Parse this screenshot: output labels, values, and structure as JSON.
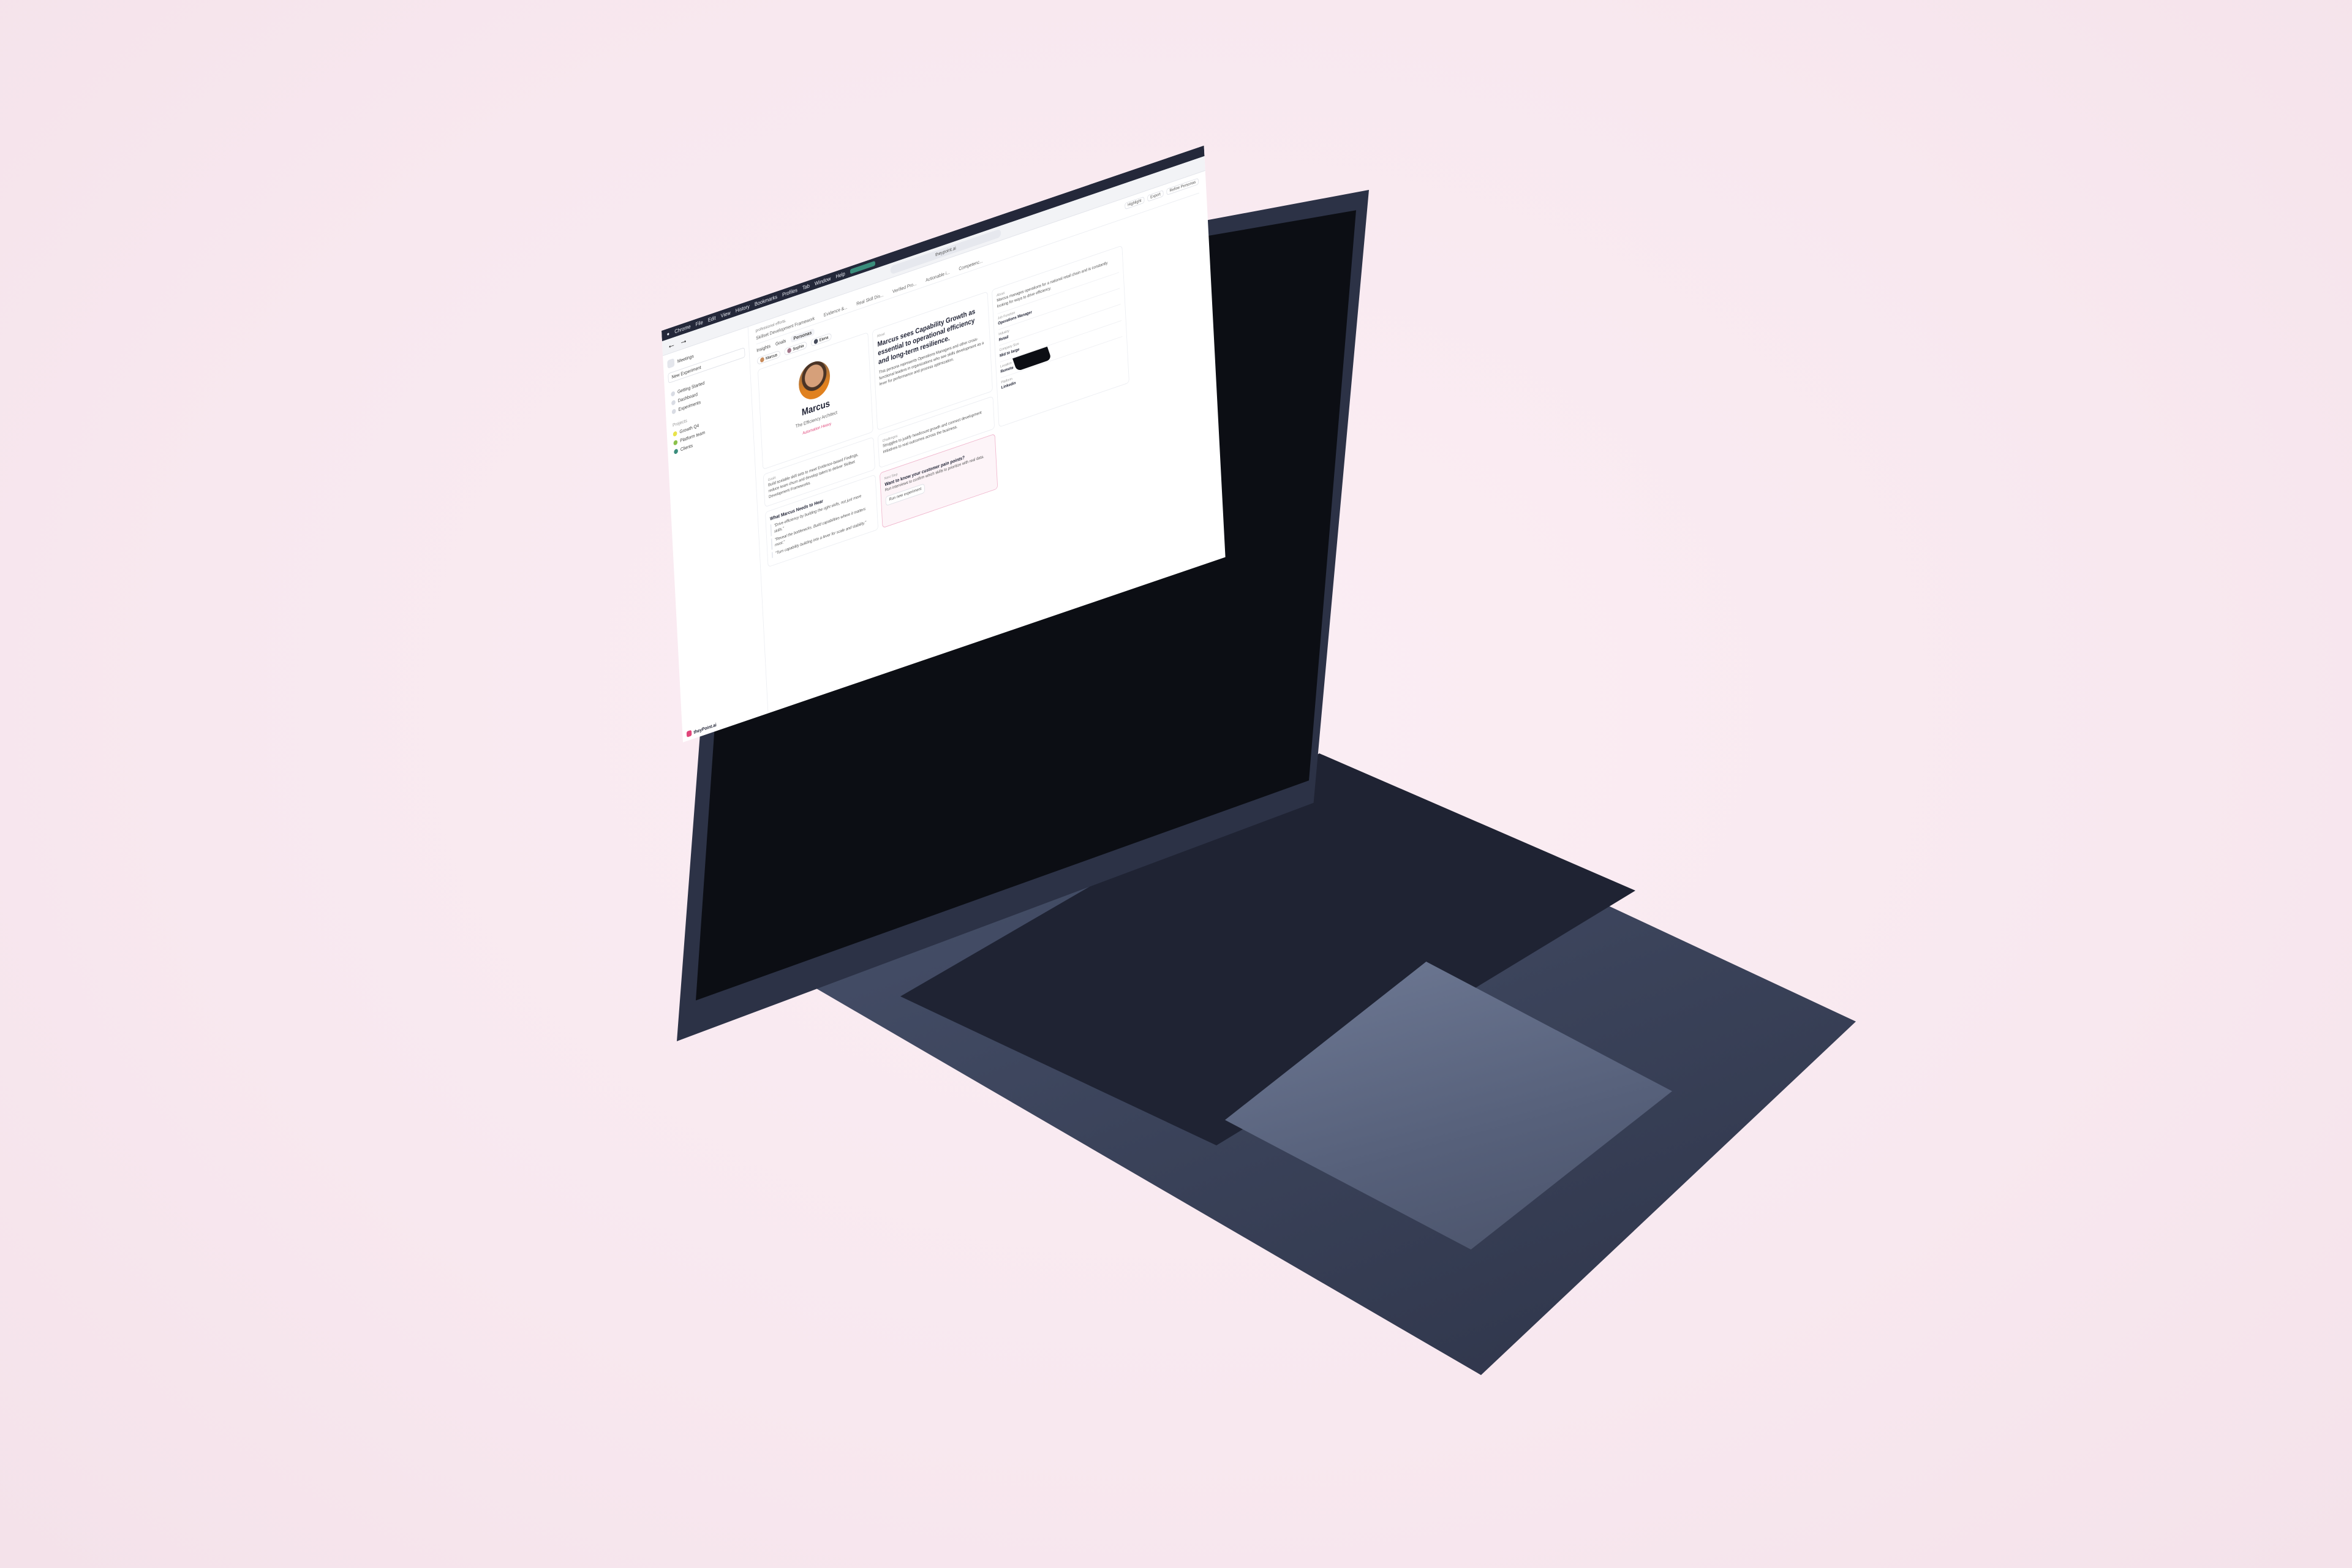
{
  "menubar": {
    "app": "Chrome",
    "items": [
      "File",
      "Edit",
      "View",
      "History",
      "Bookmarks",
      "Profiles",
      "Tab",
      "Window",
      "Help"
    ]
  },
  "browser": {
    "url": "theypoint.ai"
  },
  "sidebar": {
    "org": "Meetings",
    "new_button": "New Experiment",
    "nav": [
      "Getting Started",
      "Dashboard",
      "Experiments"
    ],
    "section": "Projects",
    "projects": [
      {
        "label": "Growth Q4",
        "color": "#e8e34a"
      },
      {
        "label": "Platform team",
        "color": "#8bc14a"
      },
      {
        "label": "Clients",
        "color": "#3a8d7c"
      }
    ]
  },
  "main": {
    "topbar_text": "professional efforts.",
    "tabs": [
      "Skillset Development Framework",
      "Evidence &...",
      "Real Skill Dis...",
      "Verified Pro...",
      "Actionable i...",
      "Competenc..."
    ],
    "subtabs": [
      "Insights",
      "Goals",
      "Personas"
    ],
    "personas": [
      "Marcus",
      "Sophia",
      "Elena"
    ],
    "tools": [
      "Highlight",
      "Export",
      "Refine Personas"
    ],
    "persona": {
      "name": "Marcus",
      "role": "The Efficiency Architect",
      "tag": "Automation Heavy"
    },
    "summary": {
      "label": "About",
      "headline": "Marcus sees Capability Growth as essential to operational efficiency and long-term resilience.",
      "body": "This persona represents Operations Managers and other cross-functional leaders in organizations who see skills development as a lever for performance and process optimization."
    },
    "goals": {
      "label": "Goals",
      "body": "Build scalable skill sets to meet Evidence-based Findings, reduce team churn and develop talent to deliver Skillset Development Frameworks."
    },
    "challenges": {
      "label": "Challenges",
      "body": "Struggles to justify headcount growth and connect development initiatives to real outcomes across the business."
    },
    "cta": {
      "label": "Next Step",
      "title": "Want to know your customer pain points?",
      "body": "Run interviews to confirm which skills to prioritize with real data.",
      "button": "Run new experiment"
    },
    "hear": {
      "title": "What Marcus Needs to Hear",
      "quotes": [
        "\"Drive efficiency by building the right skills, not just more skills.\"",
        "\"Reveal the bottlenecks. Build capabilities where it matters most.\"",
        "\"Turn capability building into a lever for scale and stability.\""
      ]
    },
    "right_panel": {
      "label": "About",
      "intro": "Marcus manages operations for a national retail chain and is constantly looking for ways to drive efficiency.",
      "rows": [
        {
          "k": "Job Function",
          "v": "Operations Manager"
        },
        {
          "k": "Industry",
          "v": "Retail"
        },
        {
          "k": "Company Size",
          "v": "Mid to large"
        },
        {
          "k": "Location",
          "v": "Remote"
        },
        {
          "k": "Platform",
          "v": "Linkedin"
        }
      ]
    },
    "footer": "theyPoint.ai"
  }
}
